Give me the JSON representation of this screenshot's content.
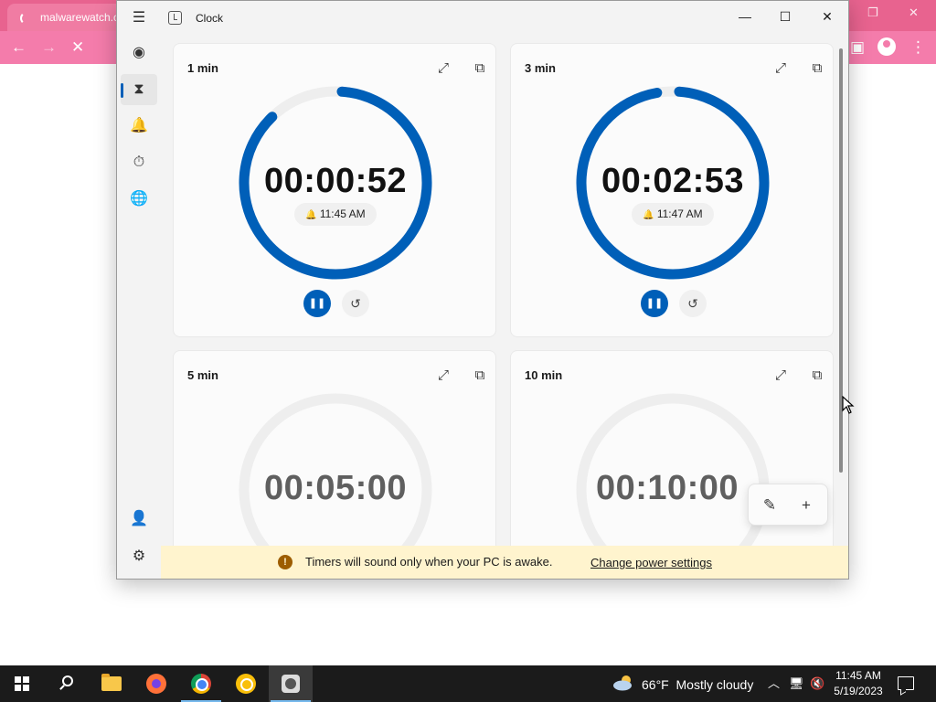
{
  "browser": {
    "tab_title": "malwarewatch.c",
    "accent": "#f47cab"
  },
  "window": {
    "title": "Clock",
    "app_icon": "clock-app-icon",
    "controls": {
      "minimize": "—",
      "maximize": "☐",
      "close": "✕"
    }
  },
  "nav": {
    "items": [
      {
        "name": "focus-sessions-icon",
        "glyph": "◉"
      },
      {
        "name": "timer-icon",
        "glyph": "⧗",
        "active": true
      },
      {
        "name": "alarm-icon",
        "glyph": "🔔"
      },
      {
        "name": "stopwatch-icon",
        "glyph": "⏱"
      },
      {
        "name": "world-clock-icon",
        "glyph": "🌐"
      }
    ],
    "bottom": [
      {
        "name": "account-icon",
        "glyph": "👤"
      },
      {
        "name": "settings-icon",
        "glyph": "⚙"
      }
    ]
  },
  "timers": [
    {
      "title": "1 min",
      "time": "00:00:52",
      "alarm": "11:45 AM",
      "running": true,
      "progress_remaining": 0.867
    },
    {
      "title": "3 min",
      "time": "00:02:53",
      "alarm": "11:47 AM",
      "running": true,
      "progress_remaining": 0.961
    },
    {
      "title": "5 min",
      "time": "00:05:00",
      "running": false,
      "progress_remaining": 1.0
    },
    {
      "title": "10 min",
      "time": "00:10:00",
      "running": false,
      "progress_remaining": 1.0
    }
  ],
  "colors": {
    "accent_blue": "#005fb8",
    "ring_track": "#eeeeee",
    "info_bar": "#fff4ce",
    "info_icon": "#9d5d00"
  },
  "fab": {
    "edit_icon": "pencil-icon",
    "add_icon": "plus-icon"
  },
  "info_bar": {
    "icon": "!",
    "message": "Timers will sound only when your PC is awake.",
    "link": "Change power settings"
  },
  "taskbar": {
    "weather": {
      "temp": "66°F",
      "condition": "Mostly cloudy"
    },
    "time": "11:45 AM",
    "date": "5/19/2023"
  }
}
